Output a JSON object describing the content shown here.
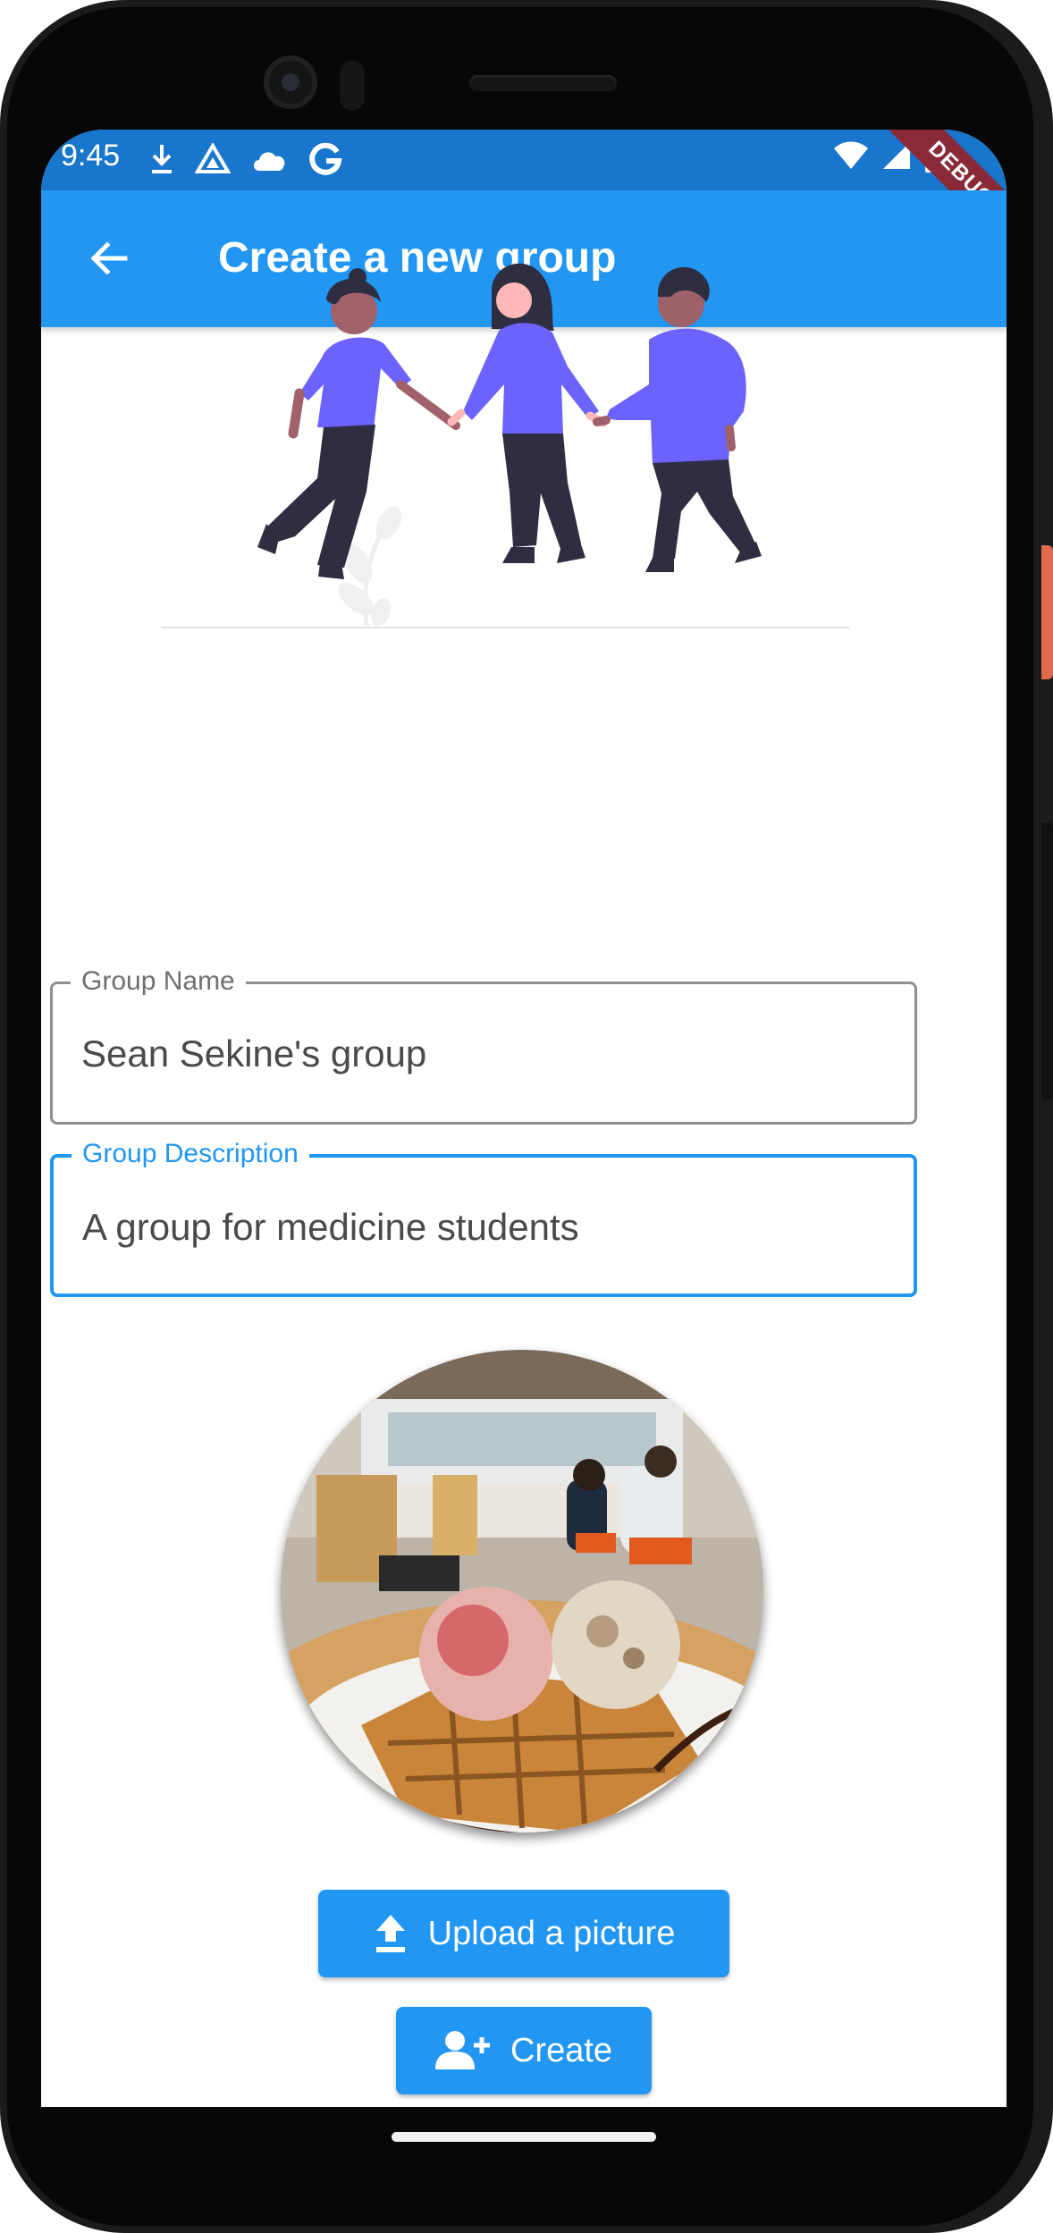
{
  "status_bar": {
    "time": "9:45",
    "left_icons": [
      "download-icon",
      "drive-icon",
      "cloud-icon",
      "google-icon"
    ],
    "right_icons": [
      "wifi-icon",
      "signal-icon",
      "battery-icon"
    ],
    "debug_label": "DEBUG"
  },
  "app_bar": {
    "title": "Create a new group",
    "back_icon": "arrow-back-icon"
  },
  "form": {
    "group_name": {
      "label": "Group Name",
      "value": "Sean Sekine's group"
    },
    "group_description": {
      "label": "Group Description",
      "value": "A group for medicine students"
    }
  },
  "actions": {
    "upload_label": "Upload a picture",
    "upload_icon": "upload-icon",
    "create_label": "Create",
    "create_icon": "person-add-icon"
  },
  "colors": {
    "primary": "#2196f3",
    "status_bar": "#1876cc",
    "figure_purple": "#6c63ff",
    "figure_dark": "#2f2e41",
    "debug_ribbon": "#8a2a38"
  }
}
